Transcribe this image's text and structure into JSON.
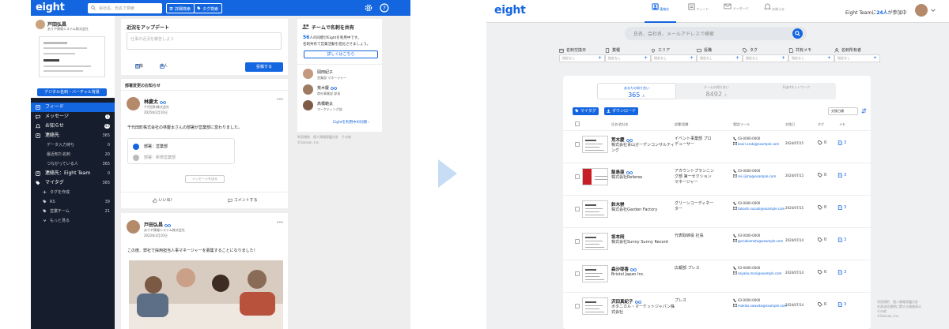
{
  "left": {
    "logo": "eight",
    "search_placeholder": "会社名、氏名で検索",
    "btn_detail": "詳細検索",
    "btn_tag": "タグ検索",
    "profile": {
      "name": "戸田弘昌",
      "company": "ありや情報システム株式会社",
      "card_button": "デジタル名刺・バーチャル背景"
    },
    "menu": [
      {
        "label": "フィード",
        "icon": "feed-icon",
        "active": true,
        "count": "",
        "badge": ""
      },
      {
        "label": "メッセージ",
        "icon": "chat-icon",
        "count": "",
        "badge": "1"
      },
      {
        "label": "お知らせ",
        "icon": "bell-icon",
        "count": "",
        "badge": "45"
      },
      {
        "label": "連絡先",
        "icon": "contacts-icon",
        "count": "365",
        "badge": ""
      }
    ],
    "submenu": [
      {
        "label": "データ入力待ち",
        "count": "0"
      },
      {
        "label": "最近知た名刺",
        "count": "20"
      },
      {
        "label": "つながっている人",
        "count": "365"
      }
    ],
    "menu_team": {
      "label": "連絡先：Eight Team",
      "count": "0"
    },
    "menu_mytag": {
      "label": "マイタグ",
      "count": "365"
    },
    "tags": [
      {
        "label": "タグを作成",
        "icon": "plus-icon",
        "count": ""
      },
      {
        "label": "RS",
        "icon": "tag-icon",
        "count": "39"
      },
      {
        "label": "営業チーム",
        "icon": "tag-icon",
        "count": "21"
      },
      {
        "label": "もっと見る",
        "icon": "chevron-down-icon",
        "count": ""
      }
    ],
    "update": {
      "title": "近況をアップデート",
      "placeholder": "仕事の近況を報告しよう",
      "image_btn": "画像",
      "job_btn": "求人",
      "post_btn": "投稿する"
    },
    "feed_label": "部署変更のお知らせ",
    "post1": {
      "name": "林慶太",
      "company": "千代田町株式会社",
      "date": "2025年2月10日",
      "text": "千代田町株式会社の林慶太さんの部署が営業部に変わりました。",
      "new_dept": "部署：営業部",
      "old_dept": "部署：新規営業部",
      "reply": "メッセージを送る",
      "like": "いいね！",
      "comment": "コメントする"
    },
    "post2": {
      "name": "戸田弘昌",
      "company": "ありや情報システム株式会社",
      "date": "2022年3月10日",
      "text": "この度、弊社で採用担当人事マネージャーを募集することになりました！"
    },
    "share": {
      "title": "チームで名刺を共有",
      "count": "56",
      "desc1": "人の同僚がEightを利用中です。",
      "desc2": "名刺共有で営業活動を進化させましょう。",
      "button": "詳しくはこちら",
      "people": [
        {
          "name": "岡田紀子",
          "role": "営業部 マネージャー"
        },
        {
          "name": "荒木慶",
          "role": "商社事業部 部長"
        },
        {
          "name": "高橋範太",
          "role": "マーケティング部"
        }
      ],
      "more": "Eightを利用中の同僚"
    },
    "footer1": "利用規約　個人情報保護方針　その他",
    "footer2": "©Sansan, Inc."
  },
  "right": {
    "logo": "eight",
    "nav": [
      {
        "label": "連絡先",
        "icon": "contacts-icon",
        "active": true
      },
      {
        "label": "フィード",
        "icon": "feed-icon",
        "active": false
      },
      {
        "label": "メッセージ",
        "icon": "mail-icon",
        "active": false
      },
      {
        "label": "お知らせ",
        "icon": "bell-icon",
        "active": false
      }
    ],
    "team_prefix": "Eight Teamに",
    "team_count": "24人",
    "team_suffix": "が参加中",
    "search_placeholder": "氏名、会社名、メールアドレスで検索",
    "filters": [
      {
        "label": "名刺交換日",
        "icon": "calendar-icon",
        "value": "指定なし"
      },
      {
        "label": "業種",
        "icon": "building-icon",
        "value": "指定なし"
      },
      {
        "label": "エリア",
        "icon": "pin-icon",
        "value": "指定なし"
      },
      {
        "label": "役職",
        "icon": "id-icon",
        "value": "指定なし"
      },
      {
        "label": "タグ",
        "icon": "tag-icon",
        "value": "指定なし"
      },
      {
        "label": "共有メモ",
        "icon": "memo-icon",
        "value": "指定なし"
      },
      {
        "label": "名刺所有者",
        "icon": "person-icon",
        "value": "指定なし"
      }
    ],
    "tabs": [
      {
        "label": "あなたの知り合い",
        "count": "365",
        "unit": "人",
        "active": true
      },
      {
        "label": "チームの知り合い",
        "count": "8492",
        "unit": "人",
        "active": false
      },
      {
        "label": "Eightネットワーク",
        "count": "",
        "unit": "",
        "active": false
      }
    ],
    "btn_mytag": "マイタグ",
    "btn_download": "ダウンロード",
    "sort": "交換日順",
    "headers": {
      "name": "氏名/会社名",
      "dept": "部署/役職",
      "contact": "電話/メール",
      "date": "交換日",
      "tag": "タグ",
      "memo": "メモ"
    },
    "rows": [
      {
        "name": "荒木慶",
        "company": "株式会社青山ガーデンコンサルティング",
        "title": "イベント事業部 プロデューサー",
        "phone": "03-0000-0000",
        "email": "kaori.araki@example.com",
        "date": "2024/07/15",
        "tags": "0",
        "memo": "3",
        "infinity": true,
        "red": false
      },
      {
        "name": "飯島亜",
        "company": "株式会社Referee",
        "title": "アカウントプランニング部 第一セクション マネージャー",
        "phone": "03-0000-0000",
        "email": "rei.iijima@example.com",
        "date": "2024/07/15",
        "tags": "0",
        "memo": "3",
        "infinity": true,
        "red": true
      },
      {
        "name": "鈴木崇",
        "company": "株式会社Garden Factory",
        "title": "グリーンコーディネーター",
        "phone": "03-0000-0000",
        "email": "takashi.suzuki@example.com",
        "date": "2024/07/15",
        "tags": "0",
        "memo": "3",
        "infinity": false,
        "red": false
      },
      {
        "name": "坂本岡",
        "company": "株式会社Sunny Sunny Record",
        "title": "代表取締役 社長",
        "phone": "03-0000-0000",
        "email": "gorsakamoto@example.com",
        "date": "2024/07/14",
        "tags": "0",
        "memo": "3",
        "infinity": false,
        "red": false
      },
      {
        "name": "森沙耶香",
        "company": "Bristol Japan Inc.",
        "title": "広報部 プレス",
        "phone": "03-0000-0000",
        "email": "sayaka.mori@example.com",
        "date": "2024/07/14",
        "tags": "0",
        "memo": "3",
        "infinity": true,
        "red": false
      },
      {
        "name": "沢田真紀子",
        "company": "ボタニカル・マーケットジャパン株式会社",
        "title": "プレス",
        "phone": "03-0000-0000",
        "email": "makiko.sawada@example.com",
        "date": "2024/07/14",
        "tags": "0",
        "memo": "3",
        "infinity": true,
        "red": false
      }
    ],
    "footer1": "利用規約　個人情報保護方針",
    "footer2": "外部送信規律に関する情報表示",
    "footer3": "その他",
    "footer4": "©Sansan, Inc."
  },
  "colors": {
    "brand": "#1466e0",
    "sidebar": "#161e2e"
  }
}
